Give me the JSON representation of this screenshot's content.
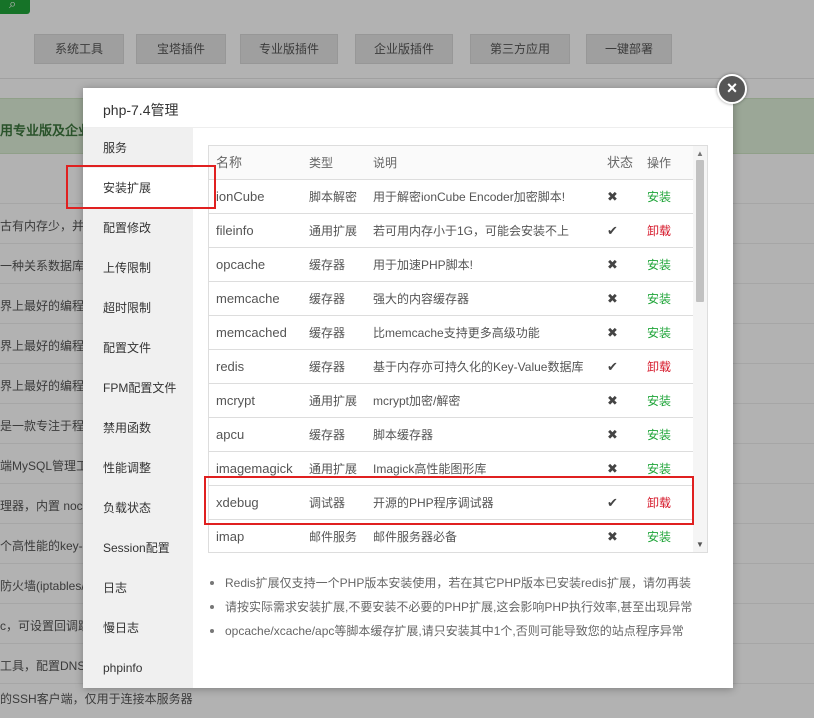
{
  "background": {
    "search_icon": "search-icon",
    "nav_tabs": [
      "系统工具",
      "宝塔插件",
      "专业版插件",
      "企业版插件",
      "第三方应用",
      "一键部署"
    ],
    "banner_text": "用专业版及企业",
    "rows": [
      "古有内存少，并2",
      "一种关系数据库",
      "界上最好的编程语",
      "界上最好的编程语",
      "界上最好的编程语",
      "是一款专注于程",
      "端MySQL管理工",
      "理器，内置 noc",
      "个高性能的key-",
      "防火墙(iptables/",
      "c，可设置回调跳",
      "工具，配置DNS",
      "的SSH客户端，仅用于连接本服务器"
    ]
  },
  "dialog": {
    "title": "php-7.4管理",
    "close_icon": "close-icon",
    "sidebar": [
      {
        "label": "服务"
      },
      {
        "label": "安装扩展"
      },
      {
        "label": "配置修改"
      },
      {
        "label": "上传限制"
      },
      {
        "label": "超时限制"
      },
      {
        "label": "配置文件"
      },
      {
        "label": "FPM配置文件"
      },
      {
        "label": "禁用函数"
      },
      {
        "label": "性能调整"
      },
      {
        "label": "负载状态"
      },
      {
        "label": "Session配置"
      },
      {
        "label": "日志"
      },
      {
        "label": "慢日志"
      },
      {
        "label": "phpinfo"
      }
    ],
    "active_sidebar": "安装扩展",
    "table": {
      "headers": {
        "name": "名称",
        "type": "类型",
        "desc": "说明",
        "status": "状态",
        "op": "操作"
      },
      "rows": [
        {
          "name": "ionCube",
          "type": "脚本解密",
          "desc": "用于解密ionCube Encoder加密脚本!",
          "status": "✖",
          "op": "安装"
        },
        {
          "name": "fileinfo",
          "type": "通用扩展",
          "desc": "若可用内存小于1G，可能会安装不上",
          "status": "✔",
          "op": "卸载"
        },
        {
          "name": "opcache",
          "type": "缓存器",
          "desc": "用于加速PHP脚本!",
          "status": "✖",
          "op": "安装"
        },
        {
          "name": "memcache",
          "type": "缓存器",
          "desc": "强大的内容缓存器",
          "status": "✖",
          "op": "安装"
        },
        {
          "name": "memcached",
          "type": "缓存器",
          "desc": "比memcache支持更多高级功能",
          "status": "✖",
          "op": "安装"
        },
        {
          "name": "redis",
          "type": "缓存器",
          "desc": "基于内存亦可持久化的Key-Value数据库",
          "status": "✔",
          "op": "卸载"
        },
        {
          "name": "mcrypt",
          "type": "通用扩展",
          "desc": "mcrypt加密/解密",
          "status": "✖",
          "op": "安装"
        },
        {
          "name": "apcu",
          "type": "缓存器",
          "desc": "脚本缓存器",
          "status": "✖",
          "op": "安装"
        },
        {
          "name": "imagemagick",
          "type": "通用扩展",
          "desc": "Imagick高性能图形库",
          "status": "✖",
          "op": "安装"
        },
        {
          "name": "xdebug",
          "type": "调试器",
          "desc": "开源的PHP程序调试器",
          "status": "✔",
          "op": "卸载"
        },
        {
          "name": "imap",
          "type": "邮件服务",
          "desc": "邮件服务器必备",
          "status": "✖",
          "op": "安装"
        }
      ]
    },
    "notes": [
      "Redis扩展仅支持一个PHP版本安装使用，若在其它PHP版本已安装redis扩展，请勿再装",
      "请按实际需求安装扩展,不要安装不必要的PHP扩展,这会影响PHP执行效率,甚至出现异常",
      "opcache/xcache/apc等脚本缓存扩展,请只安装其中1个,否则可能导致您的站点程序异常"
    ]
  },
  "colors": {
    "install": "#20a53a",
    "uninstall": "#d6182a",
    "highlight": "#e02020"
  }
}
